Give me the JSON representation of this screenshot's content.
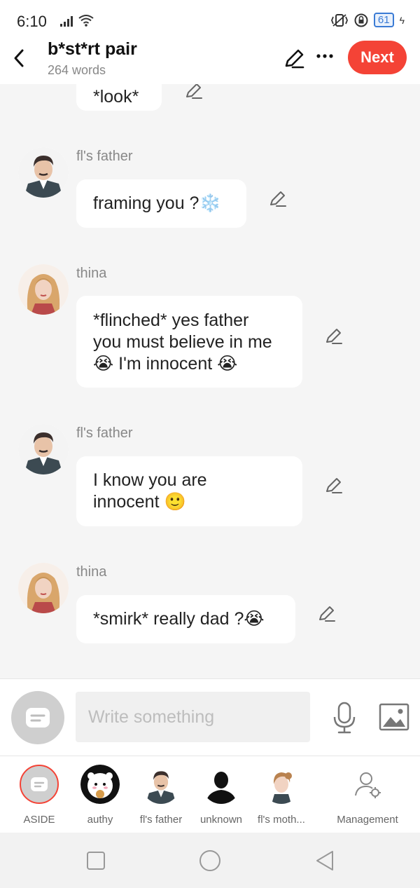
{
  "status_bar": {
    "time": "6:10",
    "battery": "61"
  },
  "header": {
    "title": "b*st*rt pair",
    "subtitle": "264 words",
    "next_label": "Next"
  },
  "messages": [
    {
      "sender": "",
      "lines": [
        "*look*"
      ]
    },
    {
      "sender": "fl's father",
      "lines": [
        "framing you ?❄️"
      ]
    },
    {
      "sender": "thina",
      "lines": [
        "*flinched* yes father",
        "you must believe in me",
        "😭 I'm innocent 😭"
      ]
    },
    {
      "sender": "fl's father",
      "lines": [
        "I know you are",
        "innocent 🙂"
      ]
    },
    {
      "sender": "thina",
      "lines": [
        "*smirk* really dad ?😭"
      ]
    }
  ],
  "composer": {
    "placeholder": "Write something"
  },
  "characters": [
    {
      "label": "ASIDE",
      "icon": "aside-icon"
    },
    {
      "label": "authy",
      "icon": "avatar"
    },
    {
      "label": "fl's father",
      "icon": "avatar"
    },
    {
      "label": "unknown",
      "icon": "silhouette-avatar"
    },
    {
      "label": "fl's moth...",
      "icon": "avatar"
    },
    {
      "label": "Management",
      "icon": "user-gear-icon"
    }
  ],
  "colors": {
    "accent": "#f44336",
    "bubble": "#ffffff",
    "background": "#f5f5f5"
  }
}
